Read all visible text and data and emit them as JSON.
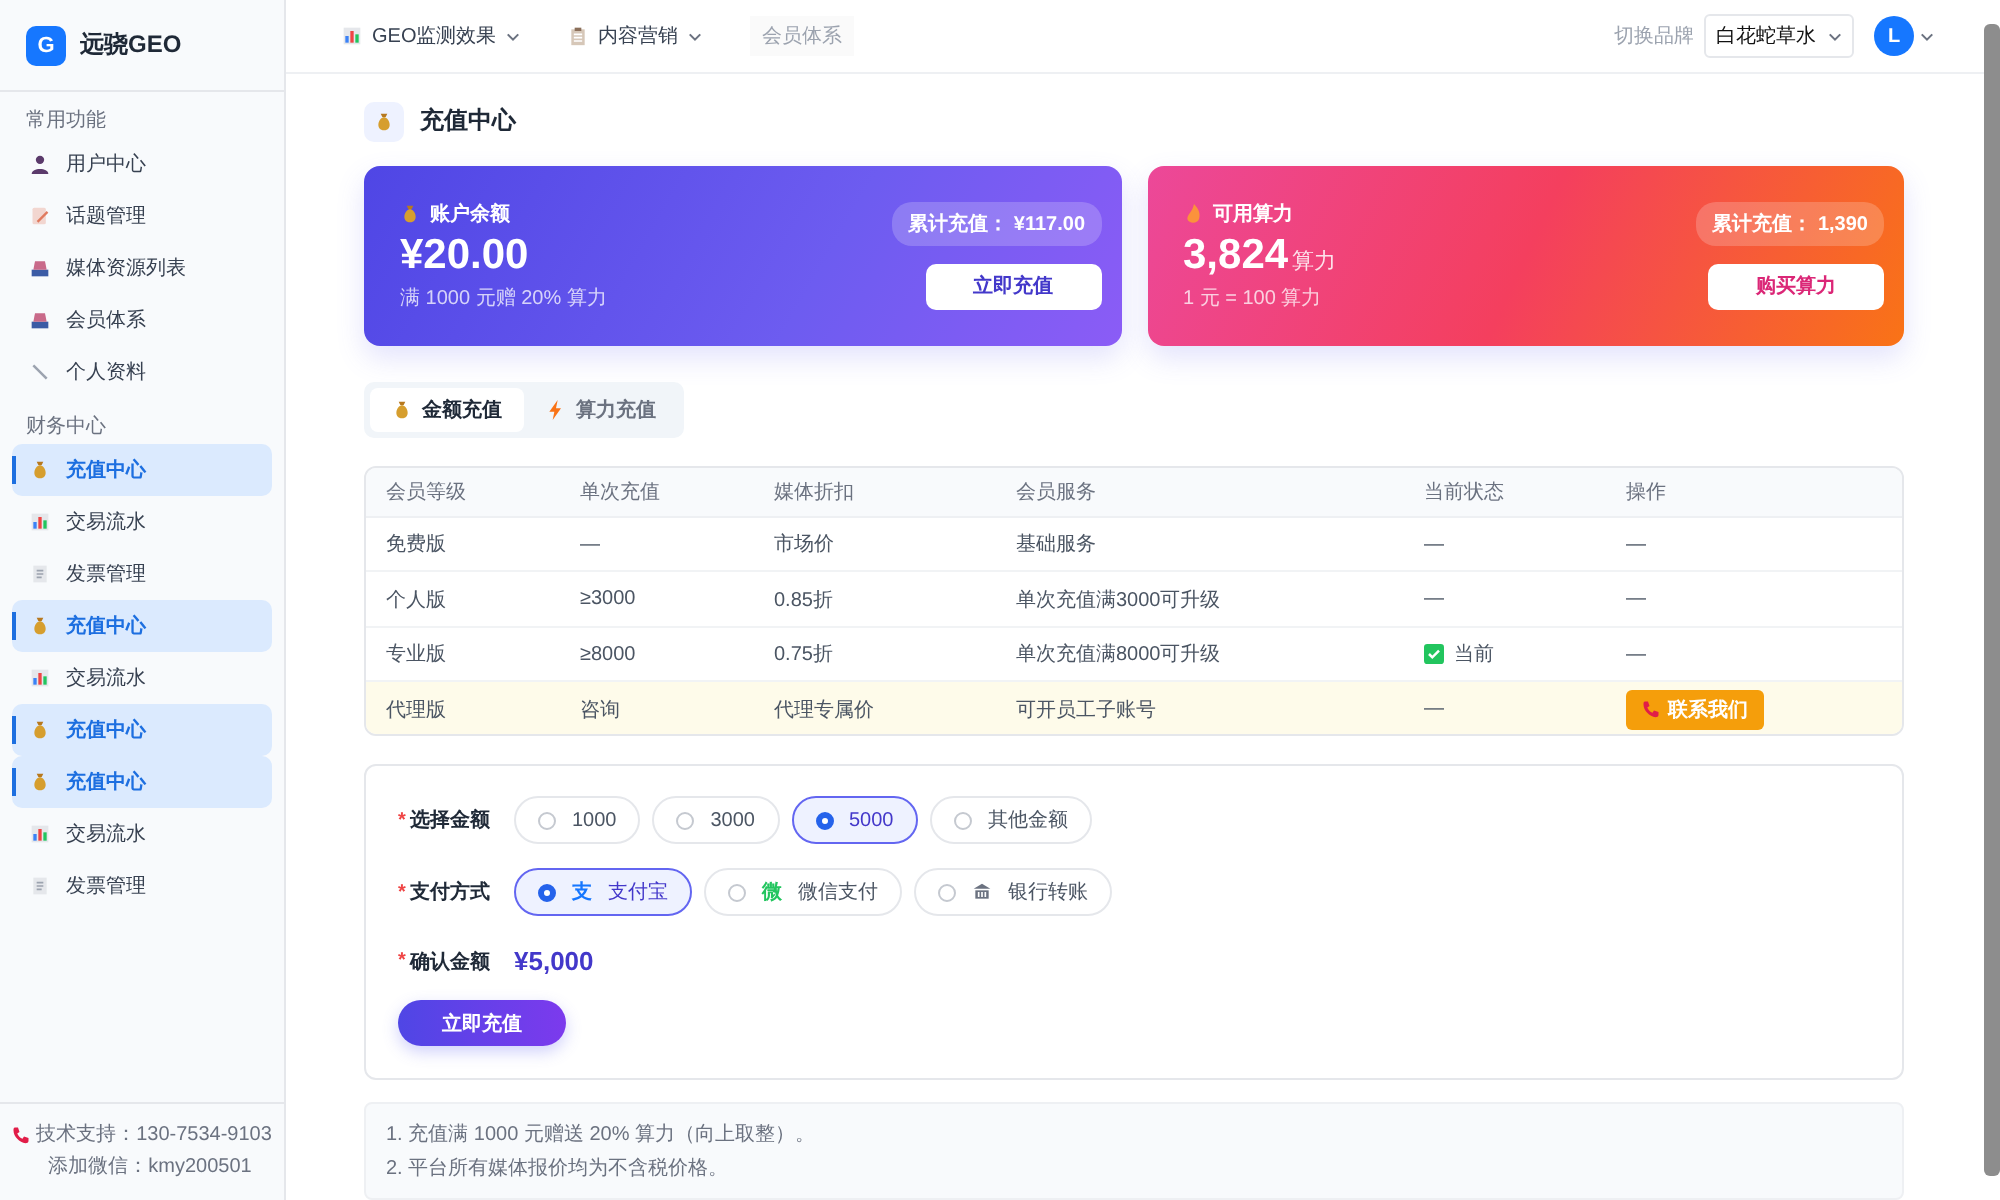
{
  "sidebar": {
    "logo_mark": "G",
    "brand": "远骁GEO",
    "sections": [
      {
        "title": "常用功能",
        "items": [
          {
            "label": "用户中心",
            "kind": "person",
            "selected": false
          },
          {
            "label": "话题管理",
            "kind": "memo",
            "selected": false
          },
          {
            "label": "媒体资源列表",
            "kind": "inbox",
            "selected": false
          },
          {
            "label": "会员体系",
            "kind": "inbox",
            "selected": false
          },
          {
            "label": "个人资料",
            "kind": "pen",
            "selected": false
          }
        ]
      },
      {
        "title": "财务中心",
        "items": [
          {
            "label": "充值中心",
            "kind": "bag",
            "selected": true
          },
          {
            "label": "交易流水",
            "kind": "chart",
            "selected": false
          },
          {
            "label": "发票管理",
            "kind": "doc",
            "selected": false
          },
          {
            "label": "充值中心",
            "kind": "bag",
            "selected": true
          },
          {
            "label": "交易流水",
            "kind": "chart",
            "selected": false
          },
          {
            "label": "充值中心",
            "kind": "bag",
            "selected": true
          },
          {
            "label": "充值中心",
            "kind": "bag",
            "selected": true
          },
          {
            "label": "交易流水",
            "kind": "chart",
            "selected": false
          },
          {
            "label": "发票管理",
            "kind": "doc",
            "selected": false
          }
        ]
      }
    ],
    "support": [
      "技术支持：130-7534-9103",
      "添加微信：kmy200501"
    ]
  },
  "header": {
    "nav": [
      {
        "label": "GEO监测效果",
        "kind": "chart",
        "dropdown": true
      },
      {
        "label": "内容营销",
        "kind": "clipboard",
        "dropdown": true
      },
      {
        "label": "会员体系",
        "kind": "plain",
        "dropdown": false
      }
    ],
    "brand_label": "切换品牌",
    "brand_select": "白花蛇草水",
    "avatar": "L"
  },
  "page_title": "充值中心",
  "cards": [
    {
      "kind": "balance",
      "title": "账户余额",
      "value": "¥20.00",
      "hint": "满 1000 元赠 20% 算力",
      "total": "累计充值： ¥117.00",
      "button": "立即充值"
    },
    {
      "kind": "compute",
      "title": "可用算力",
      "value": "3,824",
      "unit": "算力",
      "hint": "1 元 = 100 算力",
      "total": "累计充值： 1,390",
      "button": "购买算力"
    }
  ],
  "tabs": [
    {
      "label": "金额充值",
      "kind": "bag",
      "selected": true
    },
    {
      "label": "算力充值",
      "kind": "bolt",
      "selected": false
    }
  ],
  "table": {
    "columns": [
      "会员等级",
      "单次充值",
      "媒体折扣",
      "会员服务",
      "当前状态",
      "操作"
    ],
    "rows": [
      {
        "level": "免费版",
        "recharge": "—",
        "discount": "市场价",
        "service": "基础服务",
        "status": {
          "text": "—",
          "current": false
        },
        "action": {
          "kind": "text",
          "label": "—"
        },
        "highlighted": false
      },
      {
        "level": "个人版",
        "recharge": "≥3000",
        "discount": "0.85折",
        "service": "单次充值满3000可升级",
        "status": {
          "text": "—",
          "current": false
        },
        "action": {
          "kind": "text",
          "label": "—"
        },
        "highlighted": false
      },
      {
        "level": "专业版",
        "recharge": "≥8000",
        "discount": "0.75折",
        "service": "单次充值满8000可升级",
        "status": {
          "text": "当前",
          "current": true
        },
        "action": {
          "kind": "text",
          "label": "—"
        },
        "highlighted": false
      },
      {
        "level": "代理版",
        "recharge": "咨询",
        "discount": "代理专属价",
        "service": "可开员工子账号",
        "status": {
          "text": "—",
          "current": false
        },
        "action": {
          "kind": "button",
          "label": "联系我们"
        },
        "highlighted": true
      }
    ]
  },
  "form": {
    "marker": "*",
    "amount_label": "选择金额",
    "amounts": [
      {
        "label": "1000",
        "selected": false
      },
      {
        "label": "3000",
        "selected": false
      },
      {
        "label": "5000",
        "selected": true
      },
      {
        "label": "其他金额",
        "selected": false
      }
    ],
    "payment_label": "支付方式",
    "payments": [
      {
        "label": "支付宝",
        "icon_text": "支",
        "kind": "alipay",
        "selected": true
      },
      {
        "label": "微信支付",
        "icon_text": "微",
        "kind": "wechat",
        "selected": false
      },
      {
        "label": "银行转账",
        "kind": "bank",
        "selected": false
      }
    ],
    "confirm_label": "确认金额",
    "confirm_value": "¥5,000",
    "submit": "立即充值"
  },
  "notes": [
    "1. 充值满 1000 元赠送 20% 算力（向上取整）。",
    "2. 平台所有媒体报价均为不含税价格。"
  ]
}
